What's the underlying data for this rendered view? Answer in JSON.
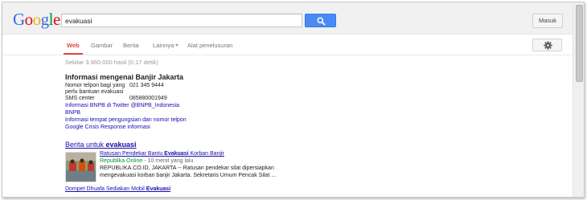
{
  "logo": {
    "letters": [
      "G",
      "o",
      "o",
      "g",
      "l",
      "e"
    ],
    "colors": [
      "#3369e8",
      "#d50f25",
      "#eeb211",
      "#3369e8",
      "#009925",
      "#d50f25"
    ]
  },
  "search": {
    "query": "evakuasi",
    "button_icon": "search-icon"
  },
  "header": {
    "signin_label": "Masuk"
  },
  "nav": {
    "tabs": [
      {
        "label": "Web",
        "active": true
      },
      {
        "label": "Gambar",
        "active": false
      },
      {
        "label": "Berita",
        "active": false
      },
      {
        "label": "Lainnya",
        "active": false
      },
      {
        "label": "Alat penelusuran",
        "active": false
      }
    ],
    "settings_icon": "gear-icon"
  },
  "stats": {
    "text": "Sekitar 3.960.000 hasil (0,17 detik)"
  },
  "info_box": {
    "title": "Informasi mengenai Banjir Jakarta",
    "rows": [
      {
        "label": "Nomor telpon bagi yang perlu bantuan evakuasi",
        "value": "021 345 9444"
      },
      {
        "label": "SMS center",
        "value": "085880001949"
      }
    ],
    "links": [
      "Informasi BNPB di Twitter @BNPB_Indonesia",
      "BNPB",
      "Informasi tempat pengungsian dan nomor telpon",
      "Google Crisis Response informasi"
    ]
  },
  "news": {
    "header_prefix": "Berita untuk ",
    "header_query": "evakuasi",
    "item": {
      "title_prefix": "Ratusan Pendekar Bantu ",
      "title_bold": "Evakuasi",
      "title_suffix": " Korban Banjir",
      "source": "Republika Online",
      "time": " - 10 menit yang lalu",
      "snippet_lines": [
        "REPUBLIKA.CO.ID, JAKARTA -- Ratusan pendekar silat dipersiapkan",
        "mengevakuasi korban banjir Jakarta. Sekretaris Umum Pencak Silat ..."
      ]
    },
    "second_prefix": "Dompet Dhuafa Sediakan Mobil ",
    "second_bold": "Evakuasi"
  },
  "colors": {
    "accent_red": "#dd4b39",
    "link_blue": "#1a0dab",
    "source_green": "#009933",
    "search_blue": "#4a8af4"
  }
}
